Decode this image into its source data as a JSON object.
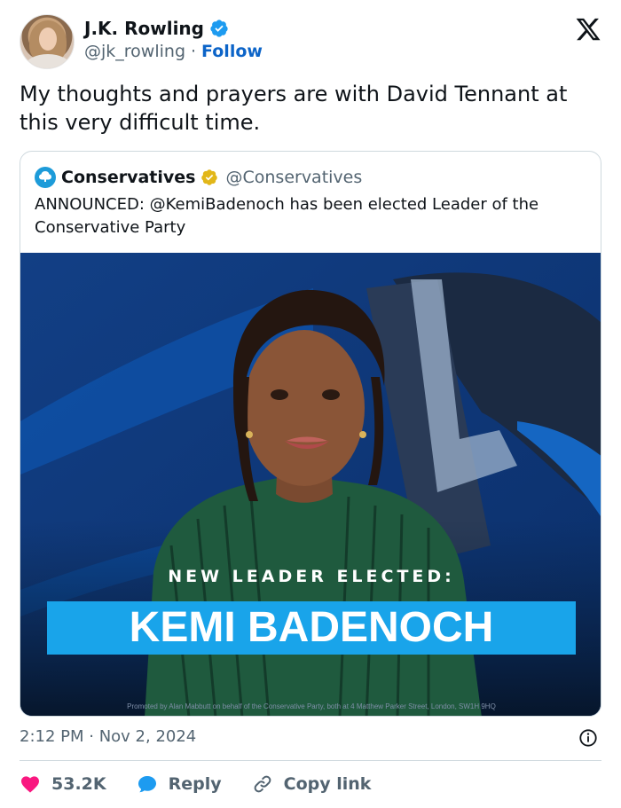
{
  "author": {
    "display_name": "J.K. Rowling",
    "handle": "@jk_rowling",
    "separator": "·",
    "follow_label": "Follow"
  },
  "tweet": {
    "text": "My thoughts and prayers are with David Tennant at this very difficult time."
  },
  "quoted": {
    "display_name": "Conservatives",
    "handle": "@Conservatives",
    "text": "ANNOUNCED: @KemiBadenoch has been elected Leader of the Conservative Party",
    "image": {
      "tagline": "NEW LEADER ELECTED:",
      "name": "KEMI BADENOCH",
      "fine_print": "Promoted by Alan Mabbutt on behalf of the Conservative Party, both at 4 Matthew Parker Street, London, SW1H 9HQ"
    }
  },
  "meta": {
    "timestamp": "2:12 PM · Nov 2, 2024"
  },
  "actions": {
    "likes": "53.2K",
    "reply_label": "Reply",
    "copy_link_label": "Copy link"
  },
  "icons": {
    "verified": "verified-badge-icon",
    "x_logo": "x-logo-icon",
    "info": "info-icon",
    "heart": "heart-icon",
    "reply": "reply-bubble-icon",
    "link": "link-icon"
  },
  "colors": {
    "text": "#0f1419",
    "secondary": "#536471",
    "follow": "#0c64c8",
    "verified_blue": "#1d9bf0",
    "verified_gold": "#e2b719",
    "heart": "#f91880",
    "reply_blue": "#1d9bf0",
    "poster_blue": "#0f3f86",
    "banner_blue": "#19a4ea"
  }
}
